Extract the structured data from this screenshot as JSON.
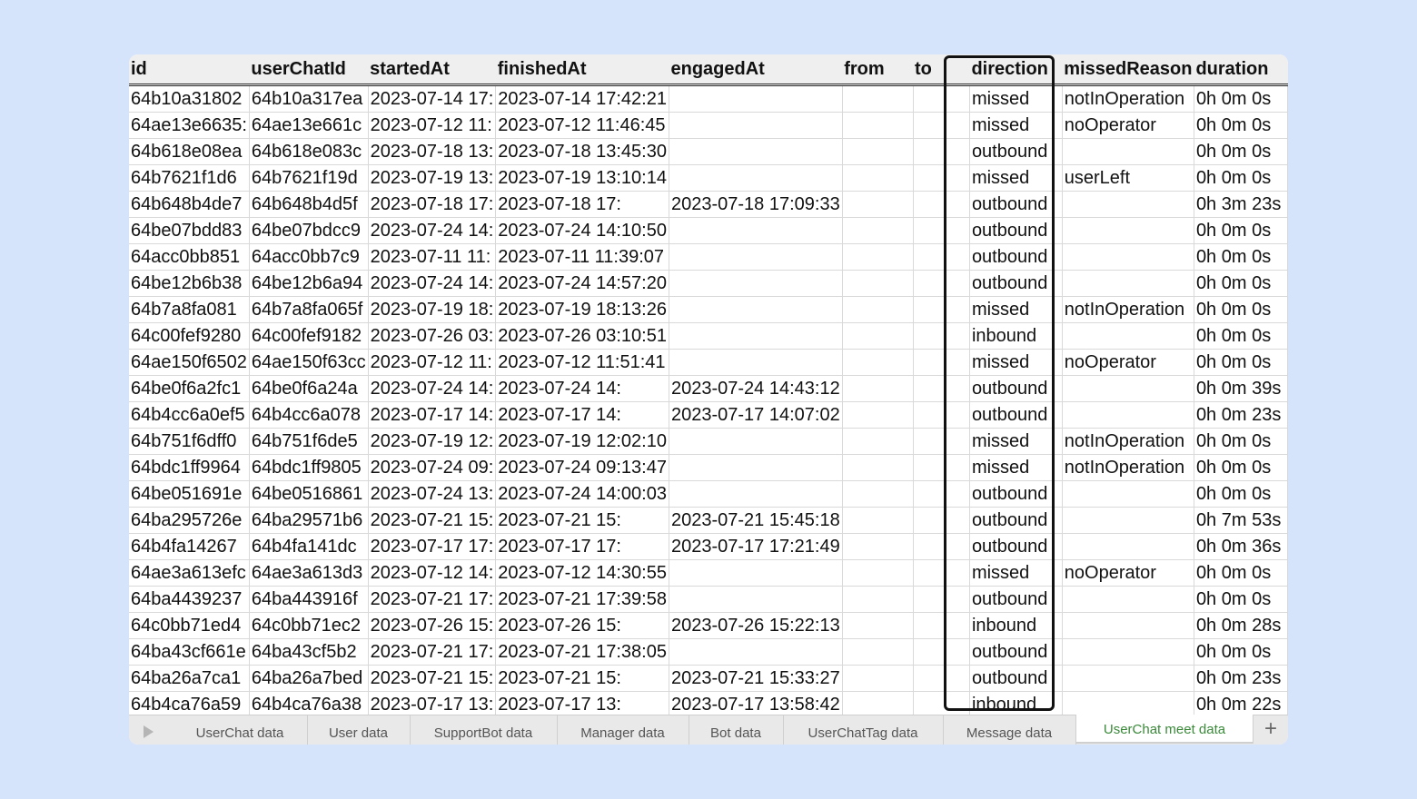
{
  "columns": [
    "id",
    "userChatId",
    "startedAt",
    "finishedAt",
    "engagedAt",
    "from",
    "to",
    "direction",
    "missedReason",
    "duration"
  ],
  "rows": [
    [
      "64b10a31802",
      "64b10a317ea",
      "2023-07-14 17:",
      "2023-07-14 17:42:21",
      "",
      "",
      "",
      "missed",
      "notInOperation",
      "0h 0m 0s"
    ],
    [
      "64ae13e6635:",
      "64ae13e661c",
      "2023-07-12 11:",
      "2023-07-12 11:46:45",
      "",
      "",
      "",
      "missed",
      "noOperator",
      "0h 0m 0s"
    ],
    [
      "64b618e08ea",
      "64b618e083c",
      "2023-07-18 13:",
      "2023-07-18 13:45:30",
      "",
      "",
      "",
      "outbound",
      "",
      "0h 0m 0s"
    ],
    [
      "64b7621f1d6",
      "64b7621f19d",
      "2023-07-19 13:",
      "2023-07-19 13:10:14",
      "",
      "",
      "",
      "missed",
      "userLeft",
      "0h 0m 0s"
    ],
    [
      "64b648b4de7",
      "64b648b4d5f",
      "2023-07-18 17:",
      "2023-07-18 17:",
      "2023-07-18 17:09:33",
      "",
      "",
      "outbound",
      "",
      "0h 3m 23s"
    ],
    [
      "64be07bdd83",
      "64be07bdcc9",
      "2023-07-24 14:",
      "2023-07-24 14:10:50",
      "",
      "",
      "",
      "outbound",
      "",
      "0h 0m 0s"
    ],
    [
      "64acc0bb851",
      "64acc0bb7c9",
      "2023-07-11 11:",
      "2023-07-11 11:39:07",
      "",
      "",
      "",
      "outbound",
      "",
      "0h 0m 0s"
    ],
    [
      "64be12b6b38",
      "64be12b6a94",
      "2023-07-24 14:",
      "2023-07-24 14:57:20",
      "",
      "",
      "",
      "outbound",
      "",
      "0h 0m 0s"
    ],
    [
      "64b7a8fa081",
      "64b7a8fa065f",
      "2023-07-19 18:",
      "2023-07-19 18:13:26",
      "",
      "",
      "",
      "missed",
      "notInOperation",
      "0h 0m 0s"
    ],
    [
      "64c00fef9280",
      "64c00fef9182",
      "2023-07-26 03:",
      "2023-07-26 03:10:51",
      "",
      "",
      "",
      "inbound",
      "",
      "0h 0m 0s"
    ],
    [
      "64ae150f6502",
      "64ae150f63cc",
      "2023-07-12 11:",
      "2023-07-12 11:51:41",
      "",
      "",
      "",
      "missed",
      "noOperator",
      "0h 0m 0s"
    ],
    [
      "64be0f6a2fc1",
      "64be0f6a24a",
      "2023-07-24 14:",
      "2023-07-24 14:",
      "2023-07-24 14:43:12",
      "",
      "",
      "outbound",
      "",
      "0h 0m 39s"
    ],
    [
      "64b4cc6a0ef5",
      "64b4cc6a078",
      "2023-07-17 14:",
      "2023-07-17 14:",
      "2023-07-17 14:07:02",
      "",
      "",
      "outbound",
      "",
      "0h 0m 23s"
    ],
    [
      "64b751f6dff0",
      "64b751f6de5",
      "2023-07-19 12:",
      "2023-07-19 12:02:10",
      "",
      "",
      "",
      "missed",
      "notInOperation",
      "0h 0m 0s"
    ],
    [
      "64bdc1ff9964",
      "64bdc1ff9805",
      "2023-07-24 09:",
      "2023-07-24 09:13:47",
      "",
      "",
      "",
      "missed",
      "notInOperation",
      "0h 0m 0s"
    ],
    [
      "64be051691e",
      "64be0516861",
      "2023-07-24 13:",
      "2023-07-24 14:00:03",
      "",
      "",
      "",
      "outbound",
      "",
      "0h 0m 0s"
    ],
    [
      "64ba295726e",
      "64ba29571b6",
      "2023-07-21 15:",
      "2023-07-21 15:",
      "2023-07-21 15:45:18",
      "",
      "",
      "outbound",
      "",
      "0h 7m 53s"
    ],
    [
      "64b4fa14267",
      "64b4fa141dc",
      "2023-07-17 17:",
      "2023-07-17 17:",
      "2023-07-17 17:21:49",
      "",
      "",
      "outbound",
      "",
      "0h 0m 36s"
    ],
    [
      "64ae3a613efc",
      "64ae3a613d3",
      "2023-07-12 14:",
      "2023-07-12 14:30:55",
      "",
      "",
      "",
      "missed",
      "noOperator",
      "0h 0m 0s"
    ],
    [
      "64ba4439237",
      "64ba443916f",
      "2023-07-21 17:",
      "2023-07-21 17:39:58",
      "",
      "",
      "",
      "outbound",
      "",
      "0h 0m 0s"
    ],
    [
      "64c0bb71ed4",
      "64c0bb71ec2",
      "2023-07-26 15:",
      "2023-07-26 15:",
      "2023-07-26 15:22:13",
      "",
      "",
      "inbound",
      "",
      "0h 0m 28s"
    ],
    [
      "64ba43cf661e",
      "64ba43cf5b2",
      "2023-07-21 17:",
      "2023-07-21 17:38:05",
      "",
      "",
      "",
      "outbound",
      "",
      "0h 0m 0s"
    ],
    [
      "64ba26a7ca1",
      "64ba26a7bed",
      "2023-07-21 15:",
      "2023-07-21 15:",
      "2023-07-21 15:33:27",
      "",
      "",
      "outbound",
      "",
      "0h 0m 23s"
    ],
    [
      "64b4ca76a59",
      "64b4ca76a38",
      "2023-07-17 13:",
      "2023-07-17 13:",
      "2023-07-17 13:58:42",
      "",
      "",
      "inbound",
      "",
      "0h 0m 22s"
    ]
  ],
  "tabs": [
    "UserChat data",
    "User data",
    "SupportBot data",
    "Manager data",
    "Bot data",
    "UserChatTag data",
    "Message data",
    "UserChat meet data"
  ],
  "active_tab": "UserChat meet data",
  "highlighted_column": "direction",
  "colors": {
    "background": "#d6e4fb",
    "header_bg": "#efefef",
    "active_tab_text": "#3a8a3a"
  }
}
